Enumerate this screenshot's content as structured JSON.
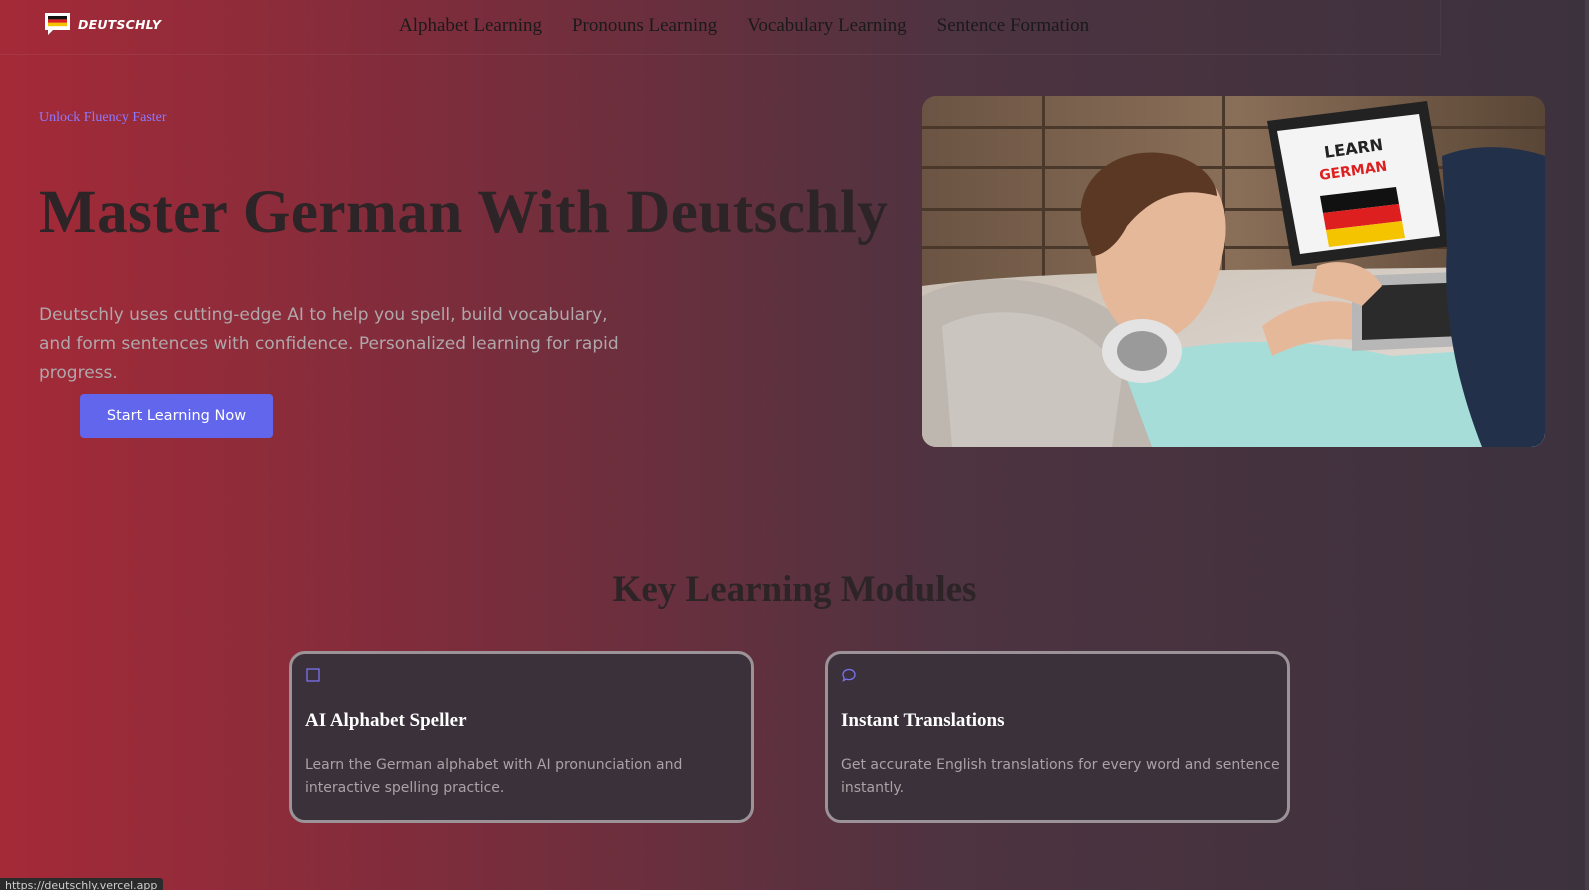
{
  "header": {
    "logo_text": "DEUTSCHLY",
    "nav": [
      "Alphabet Learning",
      "Pronouns Learning",
      "Vocabulary Learning",
      "Sentence Formation"
    ]
  },
  "hero": {
    "eyebrow": "Unlock Fluency Faster",
    "title": "Master German With Deutschly",
    "description": "Deutschly uses cutting-edge AI to help you spell, build vocabulary, and form sentences with confidence. Personalized learning for rapid progress.",
    "cta_label": "Start Learning Now",
    "image": {
      "icon": "learn-german-laptop-photo",
      "screen_text_line1": "LEARN",
      "screen_text_line2": "GERMAN"
    }
  },
  "modules": {
    "title": "Key Learning Modules",
    "cards": [
      {
        "icon": "book-icon",
        "title": "AI Alphabet Speller",
        "description": "Learn the German alphabet with AI pronunciation and interactive spelling practice."
      },
      {
        "icon": "chat-bubble-icon",
        "title": "Instant Translations",
        "description": "Get accurate English translations for every word and sentence instantly."
      }
    ]
  },
  "status_bar": {
    "url": "https://deutschly.vercel.app"
  },
  "colors": {
    "accent": "#6266ec",
    "eyebrow": "#8c79ff",
    "card_border": "#9b9398",
    "card_bg": "#3b313b"
  }
}
